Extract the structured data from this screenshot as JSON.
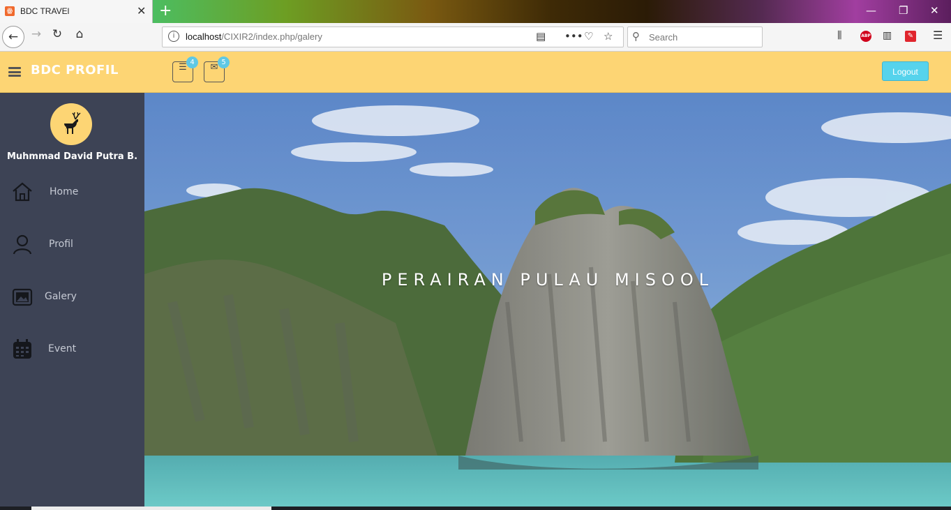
{
  "browser": {
    "tab_title": "BDC TRAVEl",
    "tab_favicon": "xampp-icon",
    "url_host": "localhost",
    "url_path": "/CIXIR2/index.php/galery",
    "search_placeholder": "Search"
  },
  "header": {
    "brand": "BDC PROFIL",
    "tasks_badge": "4",
    "messages_badge": "5",
    "logout_label": "Logout",
    "accent_color": "#fdd574",
    "logout_color": "#56d3ec"
  },
  "sidebar": {
    "username": "Muhmmad David Putra B.",
    "avatar_icon": "deer-icon",
    "items": [
      {
        "label": "Home",
        "icon": "house-icon"
      },
      {
        "label": "Profil",
        "icon": "user-icon"
      },
      {
        "label": "Galery",
        "icon": "image-icon"
      },
      {
        "label": "Event",
        "icon": "calendar-icon"
      }
    ],
    "background": "#3d4355"
  },
  "hero": {
    "title": "PERAIRAN PULAU MISOOL"
  }
}
